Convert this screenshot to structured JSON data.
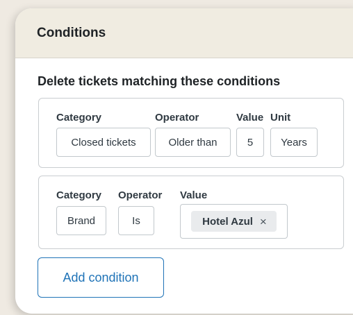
{
  "header": {
    "title": "Conditions"
  },
  "section": {
    "heading": "Delete tickets matching these conditions"
  },
  "conditions": [
    {
      "labels": {
        "category": "Category",
        "operator": "Operator",
        "value": "Value",
        "unit": "Unit"
      },
      "values": {
        "category": "Closed tickets",
        "operator": "Older than",
        "value": "5",
        "unit": "Years"
      }
    },
    {
      "labels": {
        "category": "Category",
        "operator": "Operator",
        "value": "Value"
      },
      "values": {
        "category": "Brand",
        "operator": "Is",
        "tag": "Hotel Azul",
        "tag_remove": "×"
      }
    }
  ],
  "actions": {
    "add_condition": "Add condition"
  },
  "colors": {
    "accent": "#1f73b7",
    "header_bg": "#f0ece1",
    "page_bg": "#efeae2"
  }
}
